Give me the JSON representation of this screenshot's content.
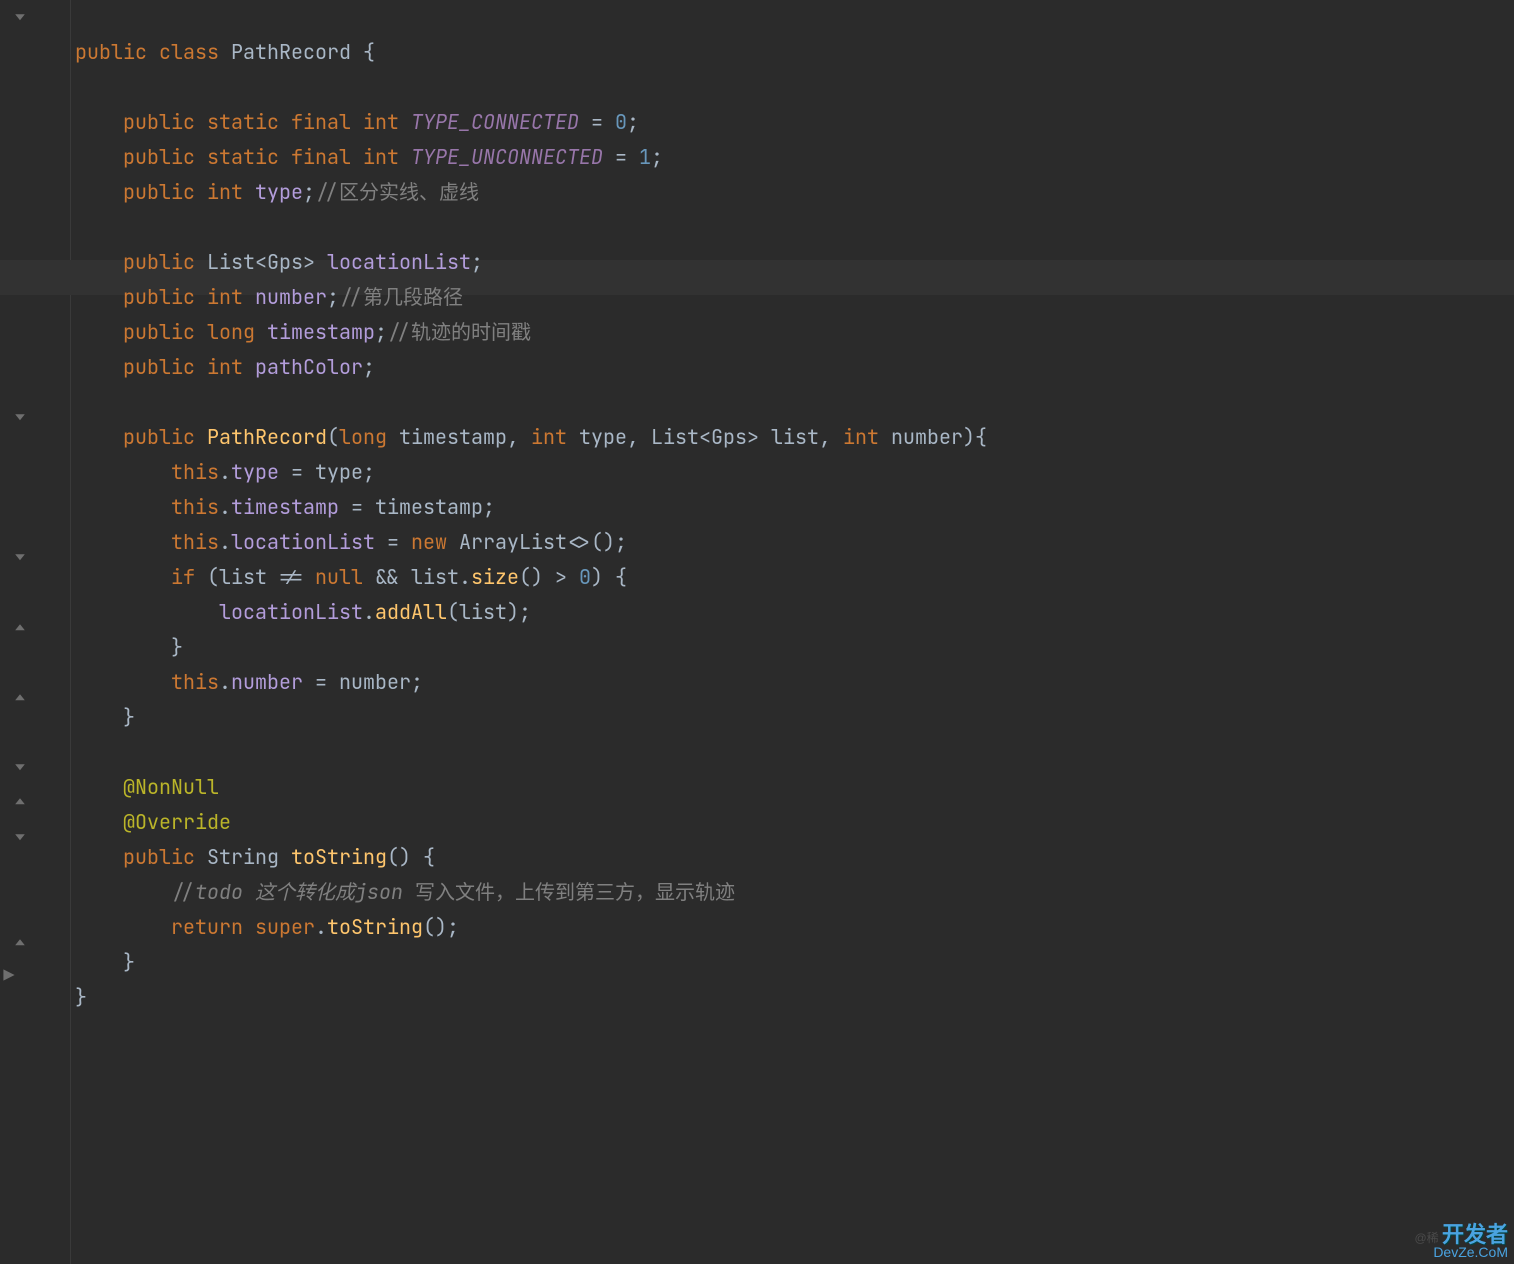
{
  "colors": {
    "keyword": "#cc7832",
    "field": "#b39ddb",
    "method": "#ffc66d",
    "number": "#6897bb",
    "comment": "#808080",
    "anno": "#bbb529",
    "staticField": "#9876aa",
    "background": "#2b2b2b",
    "lineHighlight": "#323232"
  },
  "highlightLineIndex": 7,
  "gutter": {
    "bulbAtLine": 7
  },
  "watermark": {
    "small": "@稀",
    "big": "开发者",
    "sub": "DevZe.CoM"
  },
  "code": {
    "l0": "}",
    "l1": "public class PathRecord {",
    "l2": "",
    "l3": "    public static final int TYPE_CONNECTED = 0;",
    "l4": "    public static final int TYPE_UNCONNECTED = 1;",
    "l5": "    public int type;//区分实线、虚线",
    "l6": "",
    "l7": "    public List<Gps> locationList;",
    "l8": "    public int number;//第几段路径",
    "l9": "    public long timestamp;//轨迹的时间戳",
    "l10": "    public int pathColor;",
    "l11": "",
    "l12": "    public PathRecord(long timestamp, int type, List<Gps> list, int number){",
    "l13": "        this.type = type;",
    "l14": "        this.timestamp = timestamp;",
    "l15": "        this.locationList = new ArrayList<>();",
    "l16": "        if (list != null && list.size() > 0) {",
    "l17": "            locationList.addAll(list);",
    "l18": "        }",
    "l19": "        this.number = number;",
    "l20": "    }",
    "l21": "",
    "l22": "    @NonNull",
    "l23": "    @Override",
    "l24": "    public String toString() {",
    "l25": "        //todo 这个转化成json 写入文件，上传到第三方，显示轨迹",
    "l26": "        return super.toString();",
    "l27": "    }",
    "l28": "}"
  },
  "tokens": {
    "keywords": [
      "public",
      "class",
      "static",
      "final",
      "int",
      "long",
      "if",
      "return",
      "new",
      "super",
      "this",
      "null"
    ],
    "types": [
      "PathRecord",
      "List",
      "Gps",
      "ArrayList",
      "String"
    ],
    "staticFields": [
      "TYPE_CONNECTED",
      "TYPE_UNCONNECTED"
    ],
    "fields": [
      "type",
      "locationList",
      "number",
      "timestamp",
      "pathColor",
      "list"
    ],
    "methods": [
      "PathRecord",
      "toString",
      "size",
      "addAll"
    ],
    "annotations": [
      "@NonNull",
      "@Override"
    ],
    "numbers": [
      "0",
      "1"
    ],
    "comments": [
      "//区分实线、虚线",
      "//第几段路径",
      "//轨迹的时间戳",
      "//todo 这个转化成json 写入文件，上传到第三方，显示轨迹"
    ]
  }
}
